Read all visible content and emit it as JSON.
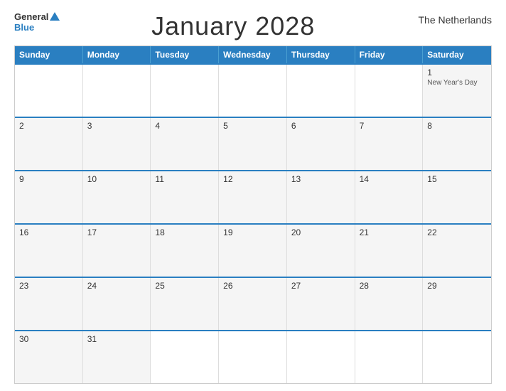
{
  "header": {
    "title": "January 2028",
    "country": "The Netherlands",
    "logo_general": "General",
    "logo_blue": "Blue"
  },
  "dayHeaders": [
    "Sunday",
    "Monday",
    "Tuesday",
    "Wednesday",
    "Thursday",
    "Friday",
    "Saturday"
  ],
  "weeks": [
    [
      {
        "day": "",
        "event": ""
      },
      {
        "day": "",
        "event": ""
      },
      {
        "day": "",
        "event": ""
      },
      {
        "day": "",
        "event": ""
      },
      {
        "day": "",
        "event": ""
      },
      {
        "day": "",
        "event": ""
      },
      {
        "day": "1",
        "event": "New Year's Day"
      }
    ],
    [
      {
        "day": "2",
        "event": ""
      },
      {
        "day": "3",
        "event": ""
      },
      {
        "day": "4",
        "event": ""
      },
      {
        "day": "5",
        "event": ""
      },
      {
        "day": "6",
        "event": ""
      },
      {
        "day": "7",
        "event": ""
      },
      {
        "day": "8",
        "event": ""
      }
    ],
    [
      {
        "day": "9",
        "event": ""
      },
      {
        "day": "10",
        "event": ""
      },
      {
        "day": "11",
        "event": ""
      },
      {
        "day": "12",
        "event": ""
      },
      {
        "day": "13",
        "event": ""
      },
      {
        "day": "14",
        "event": ""
      },
      {
        "day": "15",
        "event": ""
      }
    ],
    [
      {
        "day": "16",
        "event": ""
      },
      {
        "day": "17",
        "event": ""
      },
      {
        "day": "18",
        "event": ""
      },
      {
        "day": "19",
        "event": ""
      },
      {
        "day": "20",
        "event": ""
      },
      {
        "day": "21",
        "event": ""
      },
      {
        "day": "22",
        "event": ""
      }
    ],
    [
      {
        "day": "23",
        "event": ""
      },
      {
        "day": "24",
        "event": ""
      },
      {
        "day": "25",
        "event": ""
      },
      {
        "day": "26",
        "event": ""
      },
      {
        "day": "27",
        "event": ""
      },
      {
        "day": "28",
        "event": ""
      },
      {
        "day": "29",
        "event": ""
      }
    ],
    [
      {
        "day": "30",
        "event": ""
      },
      {
        "day": "31",
        "event": ""
      },
      {
        "day": "",
        "event": ""
      },
      {
        "day": "",
        "event": ""
      },
      {
        "day": "",
        "event": ""
      },
      {
        "day": "",
        "event": ""
      },
      {
        "day": "",
        "event": ""
      }
    ]
  ]
}
